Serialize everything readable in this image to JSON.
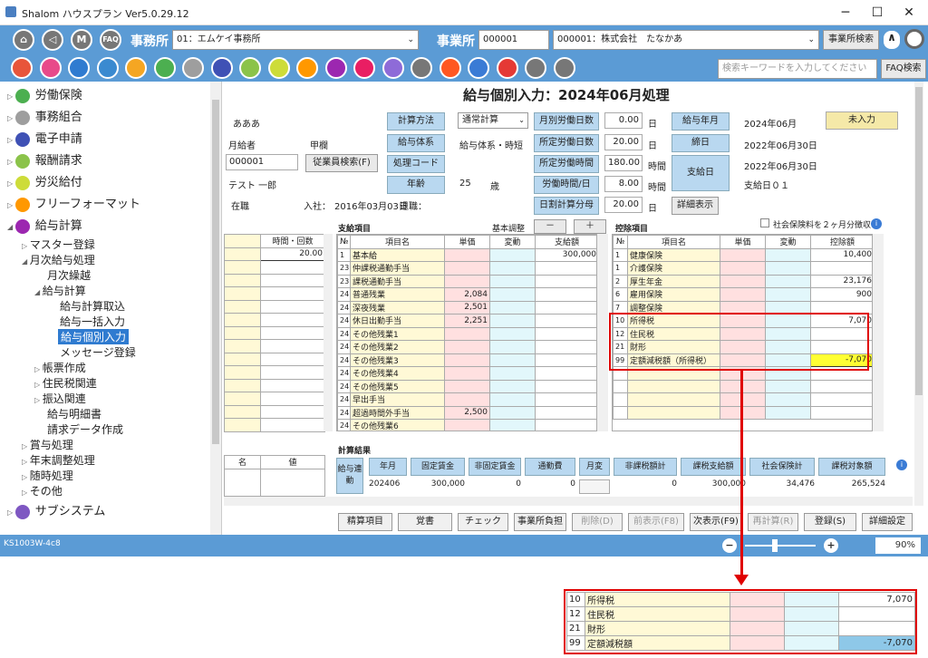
{
  "window": {
    "title": "Shalom ハウスプラン Ver5.0.29.12"
  },
  "toolbar": {
    "office_label": "事務所",
    "office_value": "01：エムケイ事務所",
    "business_label": "事業所",
    "business_code": "000001",
    "business_name": "000001：株式会社　たなかあ",
    "business_search": "事業所検索",
    "faq_icon_label": "FAQ",
    "m_icon_label": "M",
    "keyword_placeholder": "検索キーワードを入力してください",
    "faq_search": "FAQ検索"
  },
  "sidebar": {
    "items": [
      {
        "label": "労働保険"
      },
      {
        "label": "事務組合"
      },
      {
        "label": "電子申請"
      },
      {
        "label": "報酬請求"
      },
      {
        "label": "労災給付"
      },
      {
        "label": "フリーフォーマット"
      },
      {
        "label": "給与計算"
      },
      {
        "label": "マスター登録"
      },
      {
        "label": "月次給与処理"
      },
      {
        "label": "月次繰越"
      },
      {
        "label": "給与計算"
      },
      {
        "label": "給与計算取込"
      },
      {
        "label": "給与一括入力"
      },
      {
        "label": "給与個別入力"
      },
      {
        "label": "メッセージ登録"
      },
      {
        "label": "帳票作成"
      },
      {
        "label": "住民税関連"
      },
      {
        "label": "振込関連"
      },
      {
        "label": "給与明細書"
      },
      {
        "label": "請求データ作成"
      },
      {
        "label": "賞与処理"
      },
      {
        "label": "年末調整処理"
      },
      {
        "label": "随時処理"
      },
      {
        "label": "その他"
      },
      {
        "label": "サブシステム"
      }
    ]
  },
  "page": {
    "title": "給与個別入力：2024年06月処理"
  },
  "emp": {
    "a": "あああ",
    "b": "月給者",
    "c": "甲欄",
    "code": "000001",
    "search": "従業員検索(F)",
    "name": "テスト 一郎",
    "status": "在職",
    "join_label": "入社：",
    "join": "2016年03月03日",
    "leave_label": "退職："
  },
  "calc": {
    "method_btn": "計算方法",
    "method_val": "通常計算",
    "system_btn": "給与体系",
    "system_val": "給与体系・時短",
    "code_btn": "処理コード",
    "age_btn": "年齢",
    "age_val": "25",
    "age_unit": "歳"
  },
  "days": {
    "monthly_btn": "月別労働日数",
    "monthly_val": "0.00",
    "fixed_btn": "所定労働日数",
    "fixed_val": "20.00",
    "hours_btn": "所定労働時間",
    "hours_val": "180.00",
    "perday_btn": "労働時間/日",
    "perday_val": "8.00",
    "daily_btn": "日割計算分母",
    "daily_val": "20.00",
    "day_unit": "日",
    "hour_unit": "時間"
  },
  "pay": {
    "ym_btn": "給与年月",
    "ym_val": "2024年06月",
    "status": "未入力",
    "close_btn": "締日",
    "close_val": "2022年06月30日",
    "payday_btn": "支給日",
    "pay_val": "2022年06月30日",
    "pay_no": "支給日０１",
    "detail": "詳細表示"
  },
  "left_table": {
    "col": "時間・回数",
    "first": "20.00"
  },
  "payment": {
    "title": "支給項目",
    "adjust": "基本調整",
    "minus": "－",
    "plus": "＋",
    "headers": [
      "№",
      "項目名",
      "単価",
      "変動",
      "支給額"
    ],
    "rows": [
      [
        "1",
        "基本給",
        "",
        "",
        "300,000"
      ],
      [
        "23",
        "仲課税通勤手当",
        "",
        "",
        ""
      ],
      [
        "23",
        "課税通勤手当",
        "",
        "",
        ""
      ],
      [
        "24",
        "普通残業",
        "2,084",
        "",
        ""
      ],
      [
        "24",
        "深夜残業",
        "2,501",
        "",
        ""
      ],
      [
        "24",
        "休日出勤手当",
        "2,251",
        "",
        ""
      ],
      [
        "24",
        "その他残業1",
        "",
        "",
        ""
      ],
      [
        "24",
        "その他残業2",
        "",
        "",
        ""
      ],
      [
        "24",
        "その他残業3",
        "",
        "",
        ""
      ],
      [
        "24",
        "その他残業4",
        "",
        "",
        ""
      ],
      [
        "24",
        "その他残業5",
        "",
        "",
        ""
      ],
      [
        "24",
        "早出手当",
        "",
        "",
        ""
      ],
      [
        "24",
        "超過時間外手当",
        "2,500",
        "",
        ""
      ],
      [
        "24",
        "その他残業6",
        "",
        "",
        ""
      ]
    ]
  },
  "deduction": {
    "title": "控除項目",
    "check_label": "社会保険料を２ヶ月分徴収",
    "headers": [
      "№",
      "項目名",
      "単価",
      "変動",
      "控除額"
    ],
    "rows": [
      [
        "1",
        "健康保険",
        "",
        "",
        "10,400"
      ],
      [
        "1",
        "介護保険",
        "",
        "",
        ""
      ],
      [
        "2",
        "厚生年金",
        "",
        "",
        "23,176"
      ],
      [
        "6",
        "雇用保険",
        "",
        "",
        "900"
      ],
      [
        "7",
        "調整保険",
        "",
        "",
        ""
      ],
      [
        "10",
        "所得税",
        "",
        "",
        "7,070"
      ],
      [
        "12",
        "住民税",
        "",
        "",
        ""
      ],
      [
        "21",
        "財形",
        "",
        "",
        ""
      ],
      [
        "99",
        "定額減税額（所得税）",
        "",
        "",
        "-7,070"
      ]
    ]
  },
  "result": {
    "title": "計算結果",
    "link": "給与連動",
    "headers": [
      "年月",
      "固定賃金",
      "非固定賃金",
      "通勤費",
      "月変",
      "非課税額計",
      "課税支給額",
      "社会保険計",
      "課税対象額"
    ],
    "values": [
      "202406",
      "300,000",
      "0",
      "0",
      "",
      "0",
      "300,000",
      "34,476",
      "265,524"
    ]
  },
  "small_table": {
    "col1": "名",
    "col2": "値"
  },
  "buttons": {
    "b1": "精算項目",
    "b2": "覚書",
    "b3": "チェック",
    "b4": "事業所負担",
    "b5": "削除(D)",
    "b6": "前表示(F8)",
    "b7": "次表示(F9)",
    "b8": "再計算(R)",
    "b9": "登録(S)",
    "b10": "詳細設定"
  },
  "status": {
    "code": "KS1003W-4c8",
    "zoom": "90%"
  },
  "zoomed": {
    "rows": [
      [
        "10",
        "所得税",
        "7,070"
      ],
      [
        "12",
        "住民税",
        ""
      ],
      [
        "21",
        "財形",
        ""
      ],
      [
        "99",
        "定額減税額",
        "-7,070"
      ]
    ]
  }
}
